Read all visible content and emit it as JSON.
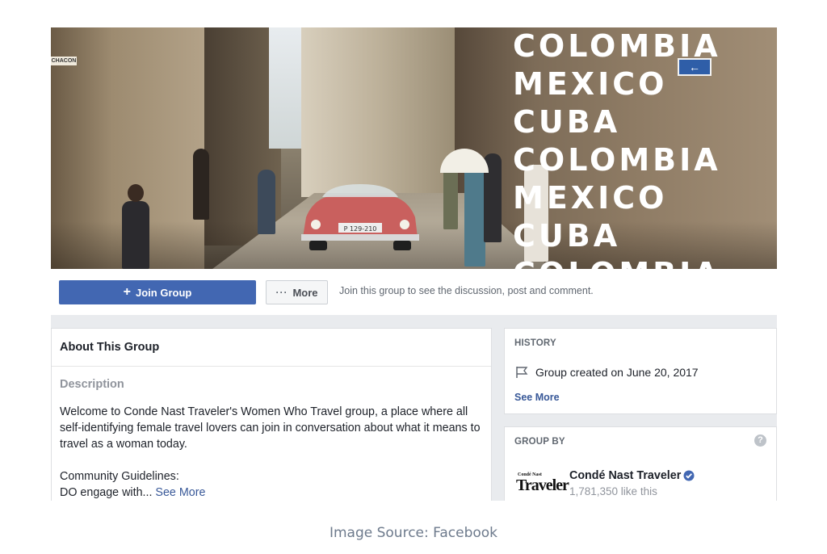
{
  "cover": {
    "street_sign": "CHACON",
    "arrow_sign": "←",
    "overlay_lines": [
      "COLOMBIA",
      "MEXICO",
      "CUBA",
      "COLOMBIA",
      "MEXICO",
      "CUBA",
      "COLOMBIA"
    ],
    "license_plate": "P 129-210"
  },
  "actions": {
    "join_icon": "+",
    "join_label": "Join Group",
    "more_icon": "···",
    "more_label": "More",
    "hint": "Join this group to see the discussion, post and comment."
  },
  "about": {
    "title": "About This Group",
    "description_title": "Description",
    "description": "Welcome to Conde Nast Traveler's Women Who Travel group, a place where all self-identifying female travel lovers can join in conversation about what it means to travel as a woman today.",
    "guidelines_line1": "Community Guidelines:",
    "guidelines_line2": "DO engage with... ",
    "see_more": "See More"
  },
  "history": {
    "label": "HISTORY",
    "created": "Group created on June 20, 2017",
    "see_more": "See More",
    "icon": "flag-icon"
  },
  "group_by": {
    "label": "GROUP BY",
    "help_icon": "?",
    "logo_small": "Condé Nast",
    "logo_big": "Traveler",
    "page_name": "Condé Nast Traveler",
    "likes": "1,781,350 like this",
    "verified_color": "#4267b2"
  },
  "caption": "Image Source: Facebook",
  "colors": {
    "primary": "#4267b2",
    "link": "#385898",
    "page_bg": "#e9ebee"
  }
}
